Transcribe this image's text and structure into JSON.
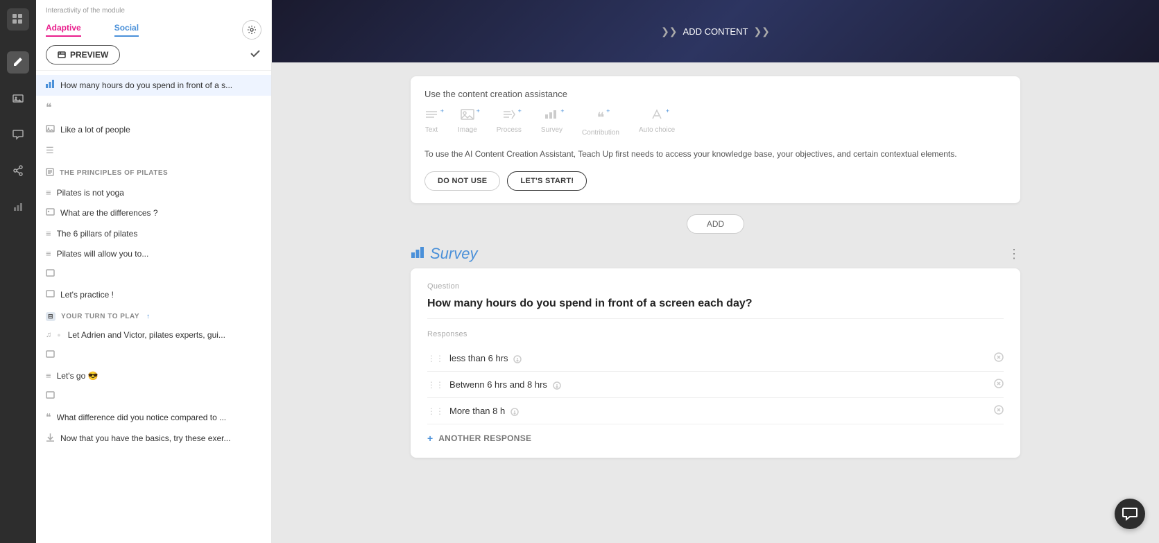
{
  "iconBar": {
    "items": [
      {
        "name": "grid-icon",
        "symbol": "⊞",
        "active": true
      },
      {
        "name": "edit-icon",
        "symbol": "✏",
        "active": false
      },
      {
        "name": "image-icon",
        "symbol": "🖼",
        "active": false
      },
      {
        "name": "chat-icon",
        "symbol": "💬",
        "active": false
      },
      {
        "name": "share-icon",
        "symbol": "⬡",
        "active": false
      },
      {
        "name": "chart-icon",
        "symbol": "📊",
        "active": false
      }
    ]
  },
  "sidebar": {
    "header_label": "Interactivity of the module",
    "tab_adaptive": "Adaptive",
    "tab_social": "Social",
    "preview_btn": "PREVIEW",
    "items_first": [
      {
        "icon": "chart-bar",
        "symbol": "▐",
        "text": "How many hours do you spend in front of a s..."
      },
      {
        "icon": "quote",
        "symbol": "❝",
        "text": ""
      },
      {
        "icon": "image",
        "symbol": "🖼",
        "text": "Like a lot of people"
      },
      {
        "icon": "list",
        "symbol": "☰",
        "text": ""
      }
    ],
    "section1_title": "THE PRINCIPLES OF PILATES",
    "section1_icon": "⊟",
    "section1_items": [
      {
        "icon": "list",
        "symbol": "☰",
        "text": "Pilates is not yoga"
      },
      {
        "icon": "image",
        "symbol": "🖼",
        "text": "What are the differences ?"
      },
      {
        "icon": "list",
        "symbol": "≡",
        "text": "The 6 pillars of pilates"
      },
      {
        "icon": "list",
        "symbol": "≡",
        "text": "Pilates will allow you to..."
      },
      {
        "icon": "image",
        "symbol": "🖼",
        "text": ""
      },
      {
        "icon": "image",
        "symbol": "🖼",
        "text": "Let's practice !"
      }
    ],
    "section2_title": "YOUR TURN TO PLAY",
    "section2_icon": "⊟",
    "section2_items": [
      {
        "icon": "music",
        "symbol": "♫",
        "text": "Let Adrien and Victor, pilates experts, gui..."
      },
      {
        "icon": "image",
        "symbol": "🖼",
        "text": ""
      },
      {
        "icon": "list",
        "symbol": "≡",
        "text": "Let's go 😎"
      },
      {
        "icon": "image",
        "symbol": "🖼",
        "text": ""
      },
      {
        "icon": "quote",
        "symbol": "❝",
        "text": "What difference did you notice compared to ..."
      },
      {
        "icon": "download",
        "symbol": "⬇",
        "text": "Now that you have the basics, try these exer..."
      }
    ]
  },
  "header": {
    "add_content": "ADD CONTENT"
  },
  "aiBox": {
    "title": "Use the content creation assistance",
    "tools": [
      {
        "name": "text",
        "label": "Text",
        "symbol": "≡",
        "has_plus": true
      },
      {
        "name": "image",
        "label": "Image",
        "symbol": "🖼",
        "has_plus": true
      },
      {
        "name": "process",
        "label": "Process",
        "symbol": "☰",
        "has_plus": true
      },
      {
        "name": "survey",
        "label": "Survey",
        "symbol": "▐",
        "has_plus": true
      },
      {
        "name": "contribution",
        "label": "Contribution",
        "symbol": "❝",
        "has_plus": true
      },
      {
        "name": "auto-choice",
        "label": "Auto choice",
        "symbol": "✏",
        "has_plus": true
      }
    ],
    "description": "To use the AI Content Creation Assistant, Teach Up first needs to access your knowledge base, your objectives, and certain contextual elements.",
    "do_not_use": "DO NOT USE",
    "lets_start": "LET'S START!"
  },
  "addBtn": "ADD",
  "survey": {
    "title": "Survey",
    "question_label": "Question",
    "question_text": "How many hours do you spend in front of a screen each day?",
    "responses_label": "Responses",
    "responses": [
      {
        "text": "less than 6 hrs ⓘ",
        "id": 1
      },
      {
        "text": "Betwenn 6 hrs and 8 hrs ⓘ",
        "id": 2
      },
      {
        "text": "More than 8 h ⓘ",
        "id": 3
      }
    ],
    "add_response": "ANOTHER RESPONSE"
  },
  "chat": {
    "symbol": "💬"
  }
}
